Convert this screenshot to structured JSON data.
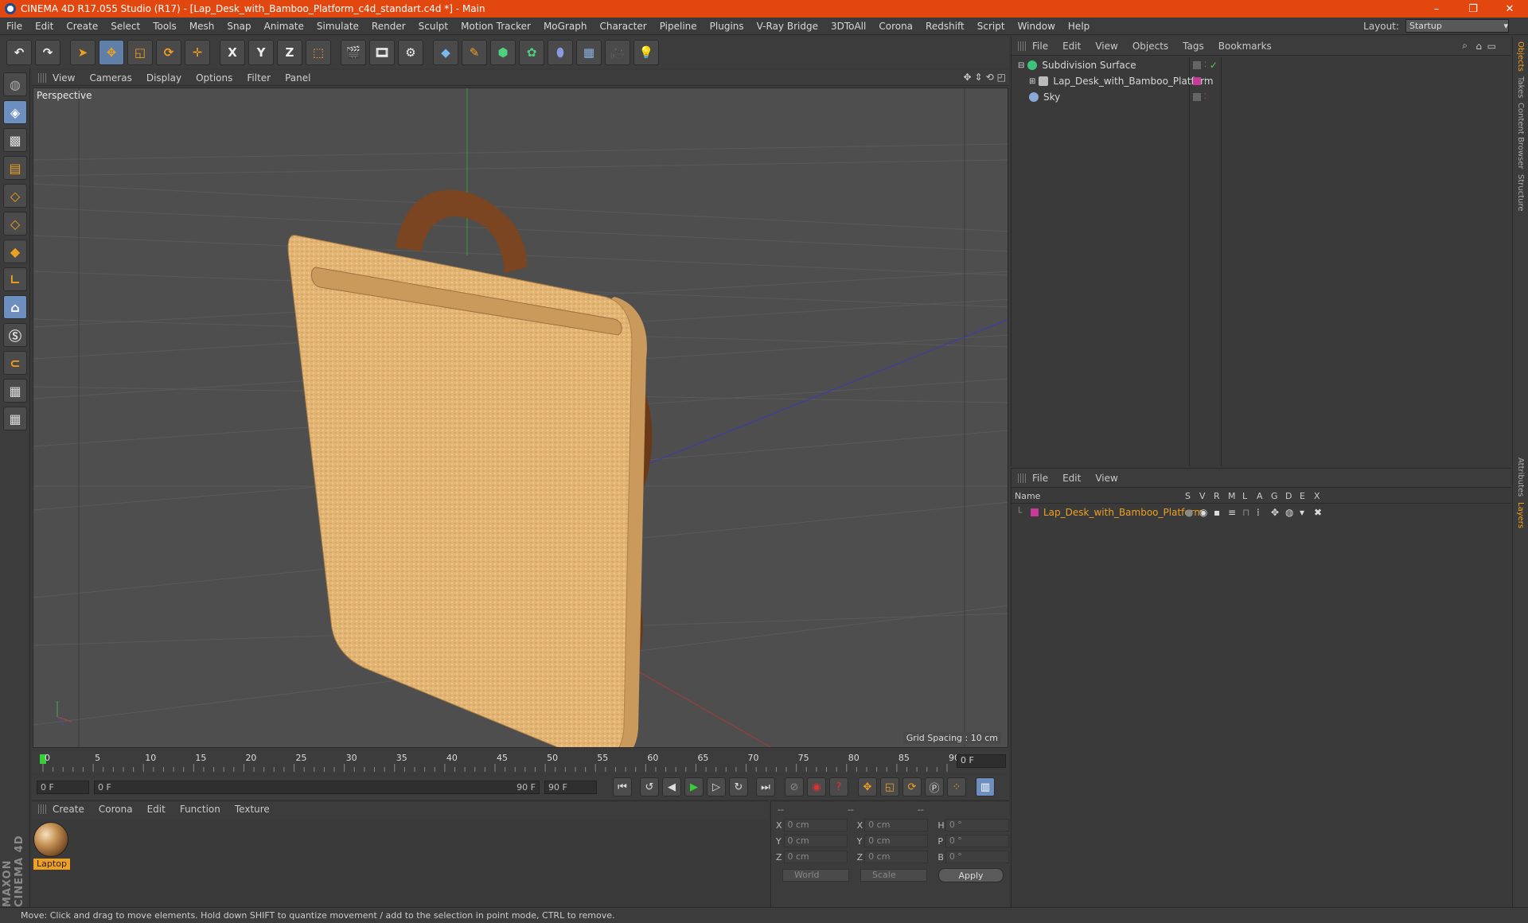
{
  "window": {
    "title": "CINEMA 4D R17.055 Studio (R17) - [Lap_Desk_with_Bamboo_Platform_c4d_standart.c4d *] - Main",
    "controls": [
      "–",
      "❐",
      "✕"
    ]
  },
  "menubar": {
    "items": [
      "File",
      "Edit",
      "Create",
      "Select",
      "Tools",
      "Mesh",
      "Snap",
      "Animate",
      "Simulate",
      "Render",
      "Sculpt",
      "Motion Tracker",
      "MoGraph",
      "Character",
      "Pipeline",
      "Plugins",
      "V-Ray Bridge",
      "3DToAll",
      "Corona",
      "Redshift",
      "Script",
      "Window",
      "Help"
    ],
    "layout_label": "Layout:",
    "layout_value": "Startup"
  },
  "toolbar": {
    "axis_x": "X",
    "axis_y": "Y",
    "axis_z": "Z"
  },
  "viewport": {
    "menu": [
      "View",
      "Cameras",
      "Display",
      "Options",
      "Filter",
      "Panel"
    ],
    "label": "Perspective",
    "grid_spacing": "Grid Spacing : 10 cm",
    "colors": {
      "background": "#4e4e4e",
      "bamboo": "#e2b574",
      "strap": "#7a4520"
    }
  },
  "timeline": {
    "ticks": [
      "0",
      "5",
      "10",
      "15",
      "20",
      "25",
      "30",
      "35",
      "40",
      "45",
      "50",
      "55",
      "60",
      "65",
      "70",
      "75",
      "80",
      "85",
      "90"
    ],
    "current_frame": "0 F",
    "start_field": "0 F",
    "range_start": "0 F",
    "range_end": "90 F",
    "end_field": "90 F"
  },
  "materials": {
    "menu": [
      "Create",
      "Corona",
      "Edit",
      "Function",
      "Texture"
    ],
    "items": [
      {
        "name": "Laptop"
      }
    ]
  },
  "coordinates": {
    "headers": [
      "--",
      "--",
      "--"
    ],
    "rows": [
      {
        "a": "X",
        "av": "0 cm",
        "b": "X",
        "bv": "0 cm",
        "c": "H",
        "cv": "0 °"
      },
      {
        "a": "Y",
        "av": "0 cm",
        "b": "Y",
        "bv": "0 cm",
        "c": "P",
        "cv": "0 °"
      },
      {
        "a": "Z",
        "av": "0 cm",
        "b": "Z",
        "bv": "0 cm",
        "c": "B",
        "cv": "0 °"
      }
    ],
    "space": "World",
    "mode": "Scale",
    "apply": "Apply"
  },
  "status": {
    "text": "Move: Click and drag to move elements. Hold down SHIFT to quantize movement / add to the selection in point mode, CTRL to remove."
  },
  "objects": {
    "menu": [
      "File",
      "Edit",
      "View",
      "Objects",
      "Tags",
      "Bookmarks"
    ],
    "tree": [
      {
        "name": "Subdivision Surface",
        "color": "#3cc47a"
      },
      {
        "name": "Lap_Desk_with_Bamboo_Platform",
        "color": "#c73a9a"
      },
      {
        "name": "Sky",
        "color": "#8aa8d8"
      }
    ]
  },
  "layers": {
    "menu": [
      "File",
      "Edit",
      "View"
    ],
    "columns": [
      "Name",
      "S",
      "V",
      "R",
      "M",
      "L",
      "A",
      "G",
      "D",
      "E",
      "X"
    ],
    "rows": [
      {
        "name": "Lap_Desk_with_Bamboo_Platform",
        "color": "#c73a9a"
      }
    ]
  },
  "edge_tabs": [
    "Objects",
    "Takes",
    "Content Browser",
    "Structure",
    "Attributes",
    "Layers"
  ]
}
